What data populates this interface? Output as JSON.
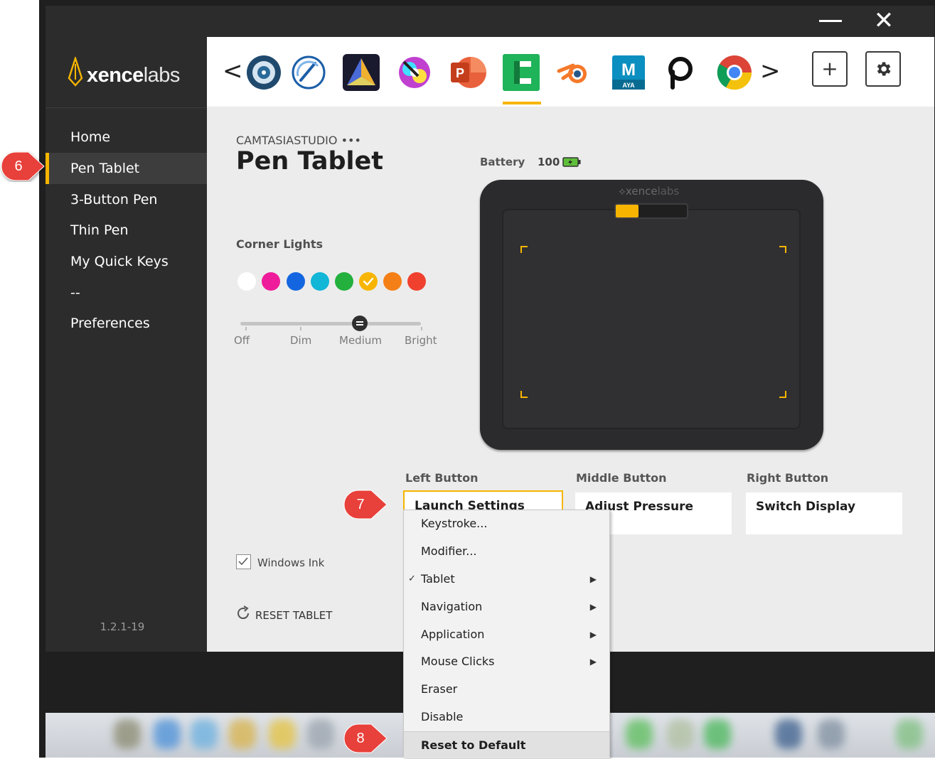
{
  "window": {
    "minimize_label": "—",
    "close_label": "✕"
  },
  "sidebar": {
    "logo_bold": "xence",
    "logo_light": "labs",
    "items": [
      {
        "label": "Home"
      },
      {
        "label": "Pen Tablet",
        "active": true
      },
      {
        "label": "3-Button Pen"
      },
      {
        "label": "Thin Pen"
      },
      {
        "label": "My Quick Keys"
      },
      {
        "label": "--"
      },
      {
        "label": "Preferences"
      }
    ],
    "version": "1.2.1-19"
  },
  "appbar": {
    "prev_label": "<",
    "next_label": ">",
    "apps": [
      {
        "icon": "disc-app-icon"
      },
      {
        "icon": "speedometer-app-icon"
      },
      {
        "icon": "affinity-photo-icon"
      },
      {
        "icon": "color-wheel-app-icon"
      },
      {
        "icon": "powerpoint-icon",
        "letter": "P"
      },
      {
        "icon": "camtasia-icon",
        "selected": true
      },
      {
        "icon": "blender-icon"
      },
      {
        "icon": "maya-icon",
        "letter": "M",
        "sub": "AYA"
      },
      {
        "icon": "picsart-icon",
        "letter": "P"
      },
      {
        "icon": "chrome-icon"
      }
    ],
    "add_label": "+",
    "settings_icon": "gear-icon"
  },
  "content": {
    "app_name": "CAMTASIASTUDIO •••",
    "title": "Pen Tablet",
    "corner_lights": {
      "label": "Corner Lights",
      "colors": [
        "#ffffff",
        "#ee1c9a",
        "#1466e0",
        "#12b6d6",
        "#23b03d",
        "#f7b500",
        "#f57f17",
        "#f0412e"
      ],
      "selected_index": 5,
      "brightness_options": [
        "Off",
        "Dim",
        "Medium",
        "Bright"
      ],
      "brightness_selected": "Medium"
    },
    "battery": {
      "label": "Battery",
      "value": "100"
    },
    "tablet_brand_light": "xence",
    "tablet_brand_bold": "labs",
    "buttons": [
      {
        "label": "Left Button",
        "value": "Launch Settings"
      },
      {
        "label": "Middle Button",
        "value": "Adjust Pressure"
      },
      {
        "label": "Right Button",
        "value": "Switch Display"
      }
    ],
    "windows_ink": {
      "label": "Windows Ink",
      "checked": true
    },
    "reset": {
      "label": "RESET TABLET"
    }
  },
  "context_menu": {
    "items": [
      {
        "label": "Keystroke..."
      },
      {
        "label": "Modifier..."
      },
      {
        "label": "Tablet",
        "checked": true,
        "submenu": true
      },
      {
        "label": "Navigation",
        "submenu": true
      },
      {
        "label": "Application",
        "submenu": true
      },
      {
        "label": "Mouse Clicks",
        "submenu": true
      },
      {
        "label": "Eraser"
      },
      {
        "label": "Disable"
      },
      {
        "label": "Reset to Default",
        "highlighted": true
      }
    ]
  },
  "callouts": [
    {
      "number": "6",
      "color": "#e8403a"
    },
    {
      "number": "7",
      "color": "#e8403a"
    },
    {
      "number": "8",
      "color": "#e8403a"
    }
  ]
}
